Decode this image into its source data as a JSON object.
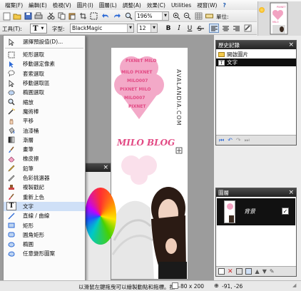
{
  "menubar": {
    "items": [
      "檔案(F)",
      "編輯(E)",
      "檢視(V)",
      "圖片(I)",
      "圖層(L)",
      "調整(A)",
      "效果(C)",
      "Utilities",
      "視窗(W)"
    ],
    "help_icon": "help-icon"
  },
  "toolbar": {
    "zoom_value": "196%",
    "units_label": "單位:"
  },
  "text_toolbar": {
    "tool_label": "工具(T):",
    "font_label": "字型:",
    "font_value": "BlackMagic",
    "size_value": "12",
    "bold": "B",
    "italic": "I",
    "underline": "U"
  },
  "tools_menu": {
    "items": [
      {
        "icon": "select-default-icon",
        "label": "選擇預設值(D)..."
      },
      {
        "icon": "rect-select-icon",
        "label": "矩形選取"
      },
      {
        "icon": "move-selected-pixels-icon",
        "label": "移動選定像素"
      },
      {
        "icon": "lasso-select-icon",
        "label": "套索選取"
      },
      {
        "icon": "move-selection-icon",
        "label": "移動選取區"
      },
      {
        "icon": "ellipse-select-icon",
        "label": "橢圓選取"
      },
      {
        "icon": "zoom-icon",
        "label": "縮放"
      },
      {
        "icon": "magic-wand-icon",
        "label": "魔術棒"
      },
      {
        "icon": "pan-icon",
        "label": "平移"
      },
      {
        "icon": "paint-bucket-icon",
        "label": "油漆桶"
      },
      {
        "icon": "gradient-icon",
        "label": "漸層"
      },
      {
        "icon": "paintbrush-icon",
        "label": "畫筆"
      },
      {
        "icon": "eraser-icon",
        "label": "橡皮擦"
      },
      {
        "icon": "pencil-icon",
        "label": "鉛筆"
      },
      {
        "icon": "color-picker-icon",
        "label": "色彩挑選器"
      },
      {
        "icon": "clone-stamp-icon",
        "label": "複製戳記"
      },
      {
        "icon": "recolor-icon",
        "label": "重新上色"
      },
      {
        "icon": "text-icon",
        "label": "文字"
      },
      {
        "icon": "line-curve-icon",
        "label": "直線 / 曲線"
      },
      {
        "icon": "rectangle-icon",
        "label": "矩形"
      },
      {
        "icon": "rounded-rectangle-icon",
        "label": "圓角矩形"
      },
      {
        "icon": "ellipse-icon",
        "label": "橢圓"
      },
      {
        "icon": "freeform-shape-icon",
        "label": "任意變形圖案"
      }
    ],
    "selected_index": 17
  },
  "history_panel": {
    "title": "歷史記錄",
    "items": [
      "開啟圖片",
      "文字"
    ],
    "selected_index": 1
  },
  "layers_panel": {
    "title": "圖層",
    "layer_name": "背景",
    "visible": true
  },
  "document": {
    "vertical_text": "AVALANDIA.COM",
    "title_text": "MILO BLOG",
    "hearts_text": "PIXNET MILO"
  },
  "statusbar": {
    "hint": "以滑鼠左鍵拖曳可以繪製動點和拖標。按一",
    "size": "80 x 200",
    "cursor": "-91, -26"
  },
  "colors": {
    "accent_select": "#cfe0f7",
    "panel_title": "#2b2b2b",
    "pink": "#e24a84",
    "canvas_bg": "#9c9c9c"
  }
}
